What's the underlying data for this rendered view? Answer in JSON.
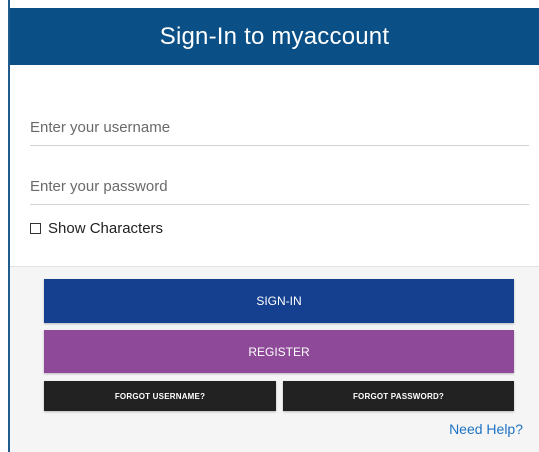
{
  "header": {
    "title": "Sign-In to myaccount"
  },
  "form": {
    "username_placeholder": "Enter your username",
    "password_placeholder": "Enter your password",
    "show_characters_label": "Show Characters",
    "show_characters_checked": false
  },
  "actions": {
    "signin_label": "SIGN-IN",
    "register_label": "REGISTER",
    "forgot_username_label": "FORGOT USERNAME?",
    "forgot_password_label": "FORGOT PASSWORD?",
    "help_link_label": "Need Help?"
  },
  "colors": {
    "header": "#0a4f85",
    "signin": "#153f8f",
    "register": "#8e4a98",
    "secondary": "#222222",
    "link": "#1f73c4"
  }
}
